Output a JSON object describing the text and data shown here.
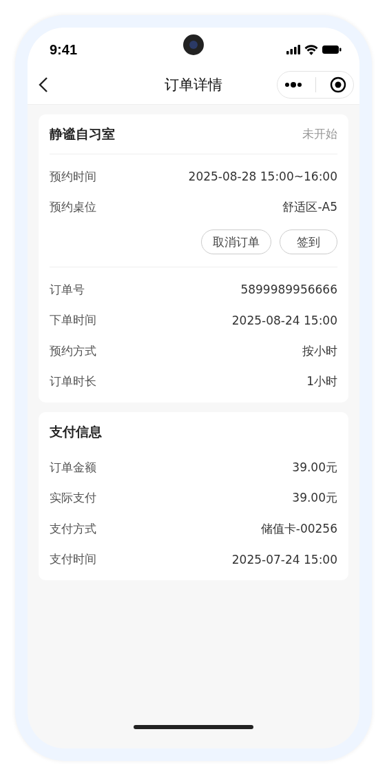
{
  "status_bar": {
    "time": "9:41"
  },
  "nav": {
    "title": "订单详情"
  },
  "order_card": {
    "room": "静谧自习室",
    "status": "未开始",
    "booking_rows": [
      {
        "label": "预约时间",
        "value": "2025-08-28 15:00~16:00"
      },
      {
        "label": "预约桌位",
        "value": "舒适区-A5"
      }
    ],
    "actions": [
      "取消订单",
      "签到"
    ],
    "detail_rows": [
      {
        "label": "订单号",
        "value": "5899989956666"
      },
      {
        "label": "下单时间",
        "value": "2025-08-24 15:00"
      },
      {
        "label": "预约方式",
        "value": "按小时"
      },
      {
        "label": "订单时长",
        "value": "1小时"
      }
    ]
  },
  "payment_card": {
    "title": "支付信息",
    "rows": [
      {
        "label": "订单金额",
        "value": "39.00元"
      },
      {
        "label": "实际支付",
        "value": "39.00元"
      },
      {
        "label": "支付方式",
        "value": "储值卡-00256"
      },
      {
        "label": "支付时间",
        "value": "2025-07-24 15:00"
      }
    ]
  }
}
